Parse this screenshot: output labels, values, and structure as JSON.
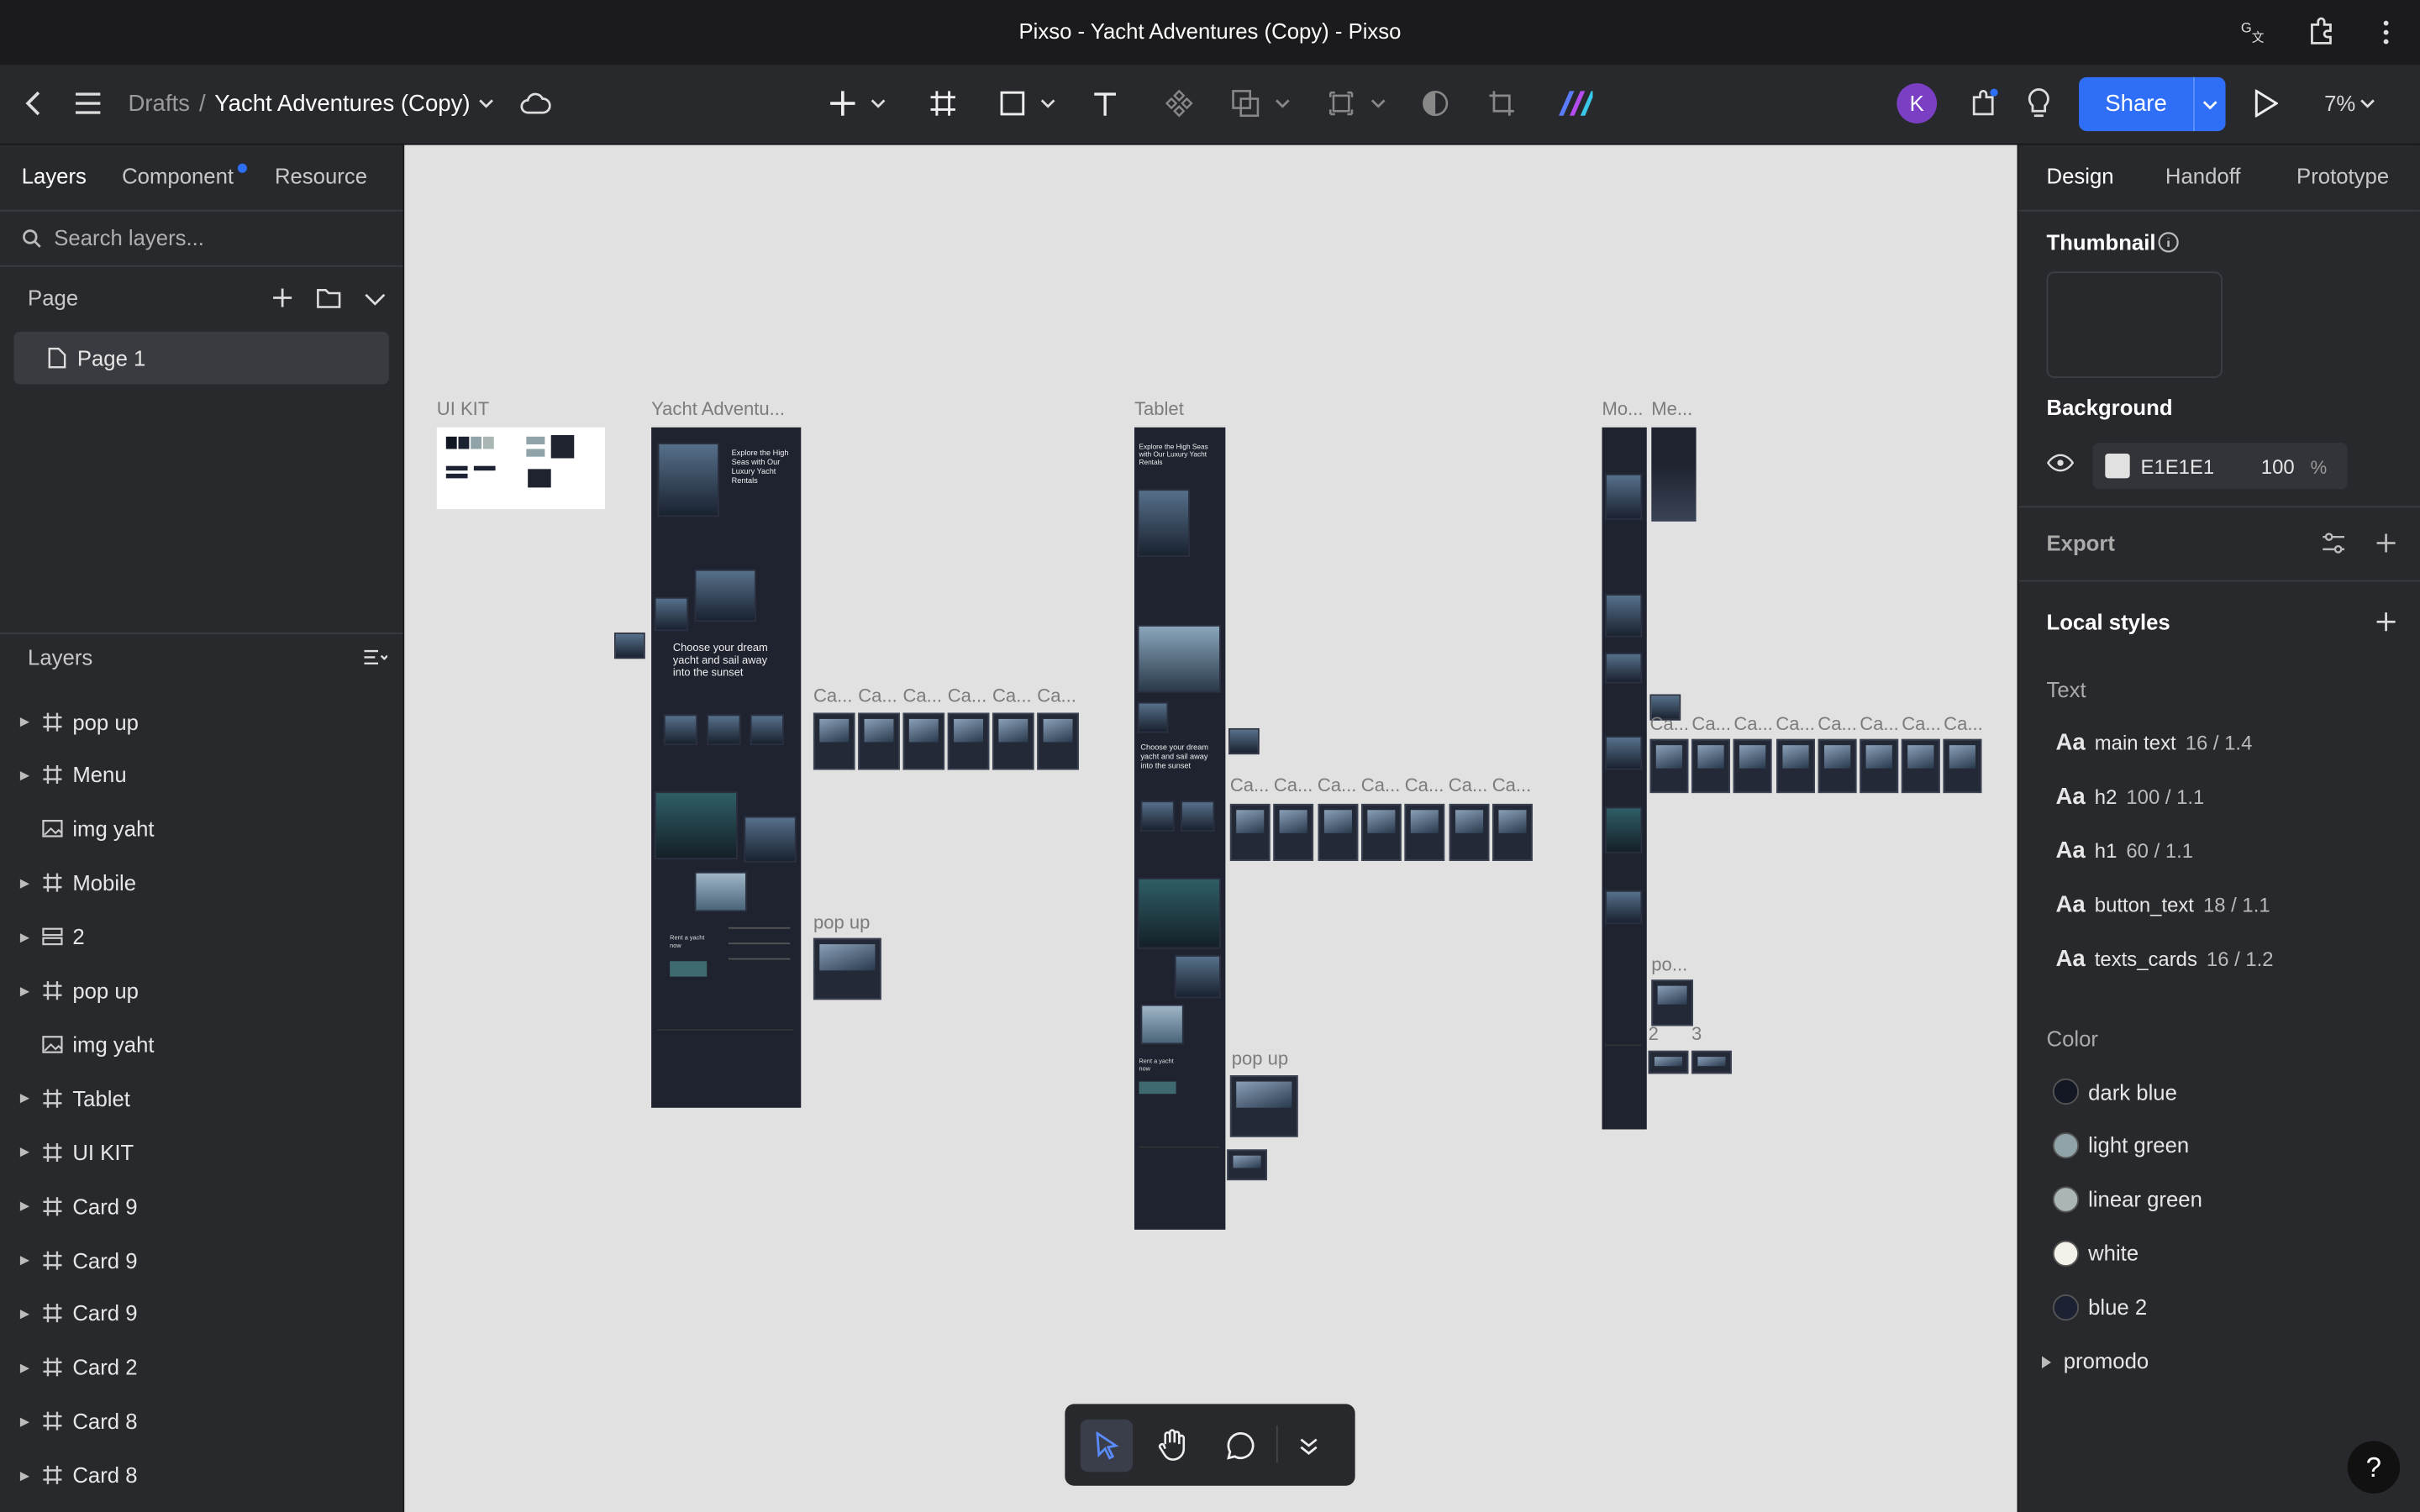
{
  "window": {
    "title": "Pixso - Yacht Adventures (Copy) - Pixso"
  },
  "toolbar": {
    "breadcrumb_drafts": "Drafts",
    "breadcrumb_sep": "/",
    "file_name": "Yacht Adventures (Copy)",
    "avatar_initial": "K",
    "share_label": "Share",
    "zoom": "7%"
  },
  "left_panel": {
    "tabs": [
      "Layers",
      "Component",
      "Resource"
    ],
    "search_placeholder": "Search layers...",
    "page_section": "Page",
    "pages": [
      "Page 1"
    ],
    "layers_section": "Layers",
    "layers": [
      {
        "name": "pop up",
        "type": "frame",
        "expandable": true
      },
      {
        "name": "Menu",
        "type": "frame",
        "expandable": true
      },
      {
        "name": "img yaht",
        "type": "image",
        "expandable": false
      },
      {
        "name": "Mobile",
        "type": "frame",
        "expandable": true
      },
      {
        "name": "2",
        "type": "stack",
        "expandable": true
      },
      {
        "name": "pop up",
        "type": "frame",
        "expandable": true
      },
      {
        "name": "img yaht",
        "type": "image",
        "expandable": false
      },
      {
        "name": "Tablet",
        "type": "frame",
        "expandable": true
      },
      {
        "name": "UI KIT",
        "type": "frame",
        "expandable": true
      },
      {
        "name": "Card 9",
        "type": "frame",
        "expandable": true
      },
      {
        "name": "Card 9",
        "type": "frame",
        "expandable": true
      },
      {
        "name": "Card 9",
        "type": "frame",
        "expandable": true
      },
      {
        "name": "Card 2",
        "type": "frame",
        "expandable": true
      },
      {
        "name": "Card 8",
        "type": "frame",
        "expandable": true
      },
      {
        "name": "Card 8",
        "type": "frame",
        "expandable": true
      }
    ]
  },
  "canvas": {
    "background": "#E1E1E1",
    "frame_labels": {
      "ui_kit": "UI KIT",
      "desktop": "Yacht Adventu...",
      "tablet": "Tablet",
      "mobile": "Mo...",
      "menu": "Me...",
      "card_short": "Ca...",
      "pop_up": "pop up",
      "pop_up_short": "po...",
      "num2": "2",
      "num3": "3"
    },
    "preview_texts": {
      "desktop_hero": "Explore the High Seas with Our Luxury Yacht Rentals",
      "desktop_sunset": "Choose your dream yacht and sail away into the sunset",
      "desktop_rent": "Rent a yacht now",
      "tablet_hero": "Explore the High Seas with Our Luxury Yacht Rentals",
      "tablet_sunset": "Choose your dream yacht and sail away into the sunset",
      "tablet_rent": "Rent a yacht now"
    }
  },
  "right_panel": {
    "tabs": [
      "Design",
      "Handoff",
      "Prototype"
    ],
    "thumbnail_label": "Thumbnail",
    "background_label": "Background",
    "background_hex": "E1E1E1",
    "background_opacity": "100",
    "percent": "%",
    "export_label": "Export",
    "local_styles_label": "Local styles",
    "text_label": "Text",
    "text_styles": [
      {
        "aa": "Aa",
        "name": "main text",
        "size": "16 / 1.4"
      },
      {
        "aa": "Aa",
        "name": "h2",
        "size": "100 / 1.1"
      },
      {
        "aa": "Aa",
        "name": "h1",
        "size": "60 / 1.1"
      },
      {
        "aa": "Aa",
        "name": "button_text",
        "size": "18 / 1.1"
      },
      {
        "aa": "Aa",
        "name": "texts_cards",
        "size": "16 / 1.2"
      }
    ],
    "color_label": "Color",
    "colors": [
      {
        "name": "dark blue",
        "hex": "#141824"
      },
      {
        "name": "light green",
        "hex": "#8fa3a8"
      },
      {
        "name": "linear green",
        "hex": "#a9b6b4"
      },
      {
        "name": "white",
        "hex": "#f4f1ea"
      },
      {
        "name": "blue 2",
        "hex": "#1d2233"
      }
    ],
    "group_label": "promodo",
    "help": "?"
  }
}
